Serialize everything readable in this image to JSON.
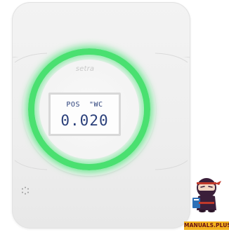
{
  "device": {
    "logo_text": "setra",
    "display": {
      "label": "POS  \"WC",
      "value": "0.020"
    },
    "status_ring_color": "#4ae070"
  },
  "watermark": {
    "brand_text": "MANUALS.PLUS",
    "banner_color": "#f2b21f"
  },
  "icons": {
    "sensor": "sensor-dots-icon",
    "mascot": "ninja-mascot-icon"
  }
}
